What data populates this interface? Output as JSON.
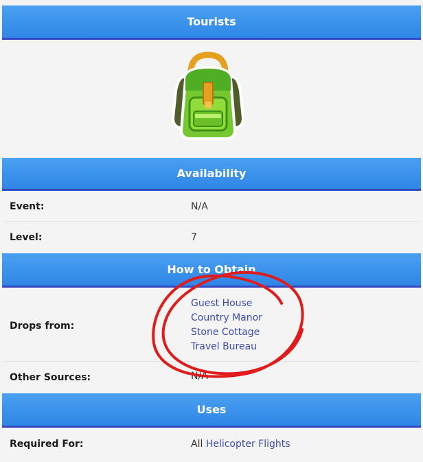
{
  "header": {
    "title": "Tourists"
  },
  "image": {
    "icon": "backpack-icon"
  },
  "availability": {
    "title": "Availability",
    "event_label": "Event:",
    "event_value": "N/A",
    "level_label": "Level:",
    "level_value": "7"
  },
  "obtain": {
    "title": "How to Obtain",
    "drops_label": "Drops from:",
    "drops": [
      "Guest House",
      "Country Manor",
      "Stone Cottage",
      "Travel Bureau"
    ],
    "other_label": "Other Sources:",
    "other_value": "N/A"
  },
  "uses": {
    "title": "Uses",
    "required_label": "Required For:",
    "required_prefix": "All",
    "required_link": "Helicopter Flights"
  },
  "colors": {
    "header": "#2f86e6",
    "link": "#3d4bb0",
    "annotation": "#e01b1b"
  }
}
